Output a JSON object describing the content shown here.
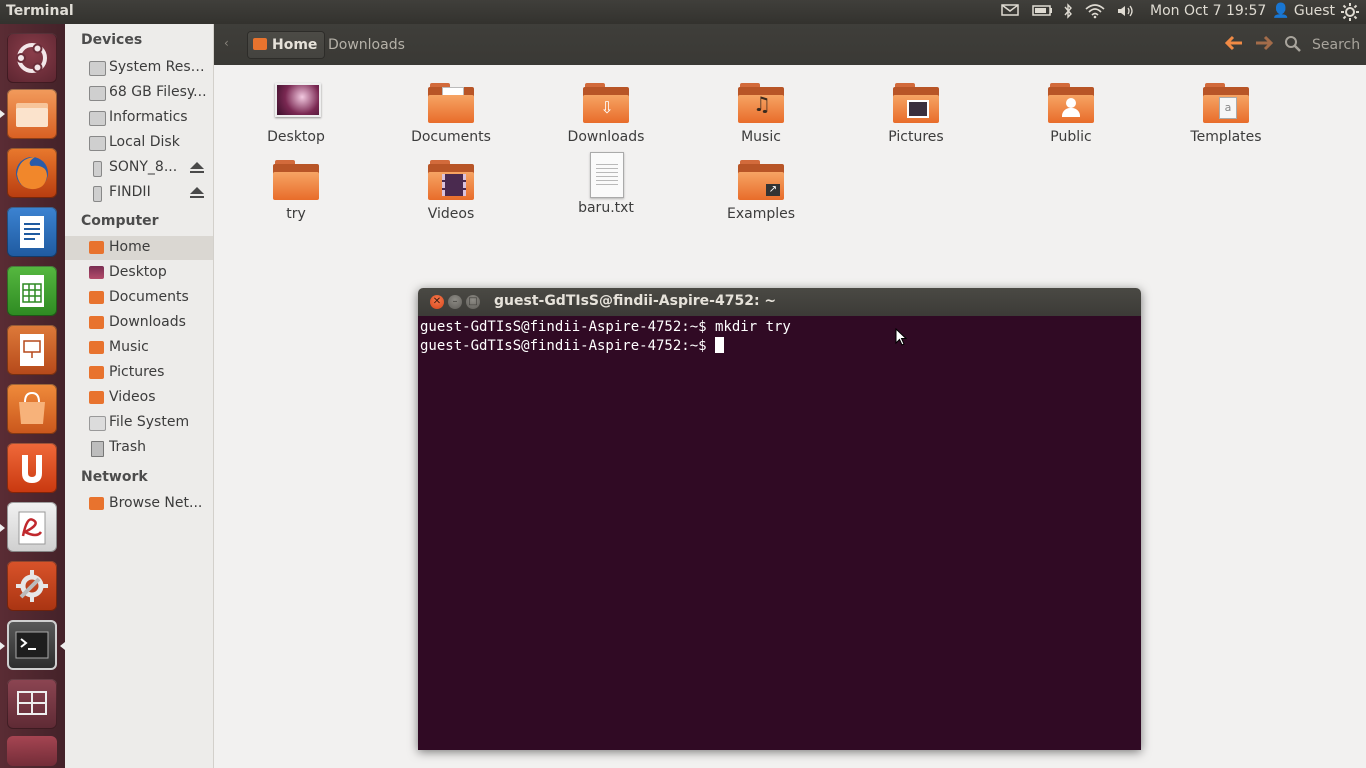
{
  "topbar": {
    "app_title": "Terminal",
    "datetime": "Mon Oct  7 19:57",
    "user": "Guest",
    "indicators": [
      "mail-icon",
      "battery-icon",
      "bluetooth-icon",
      "wifi-icon",
      "volume-icon",
      "power-gear-icon"
    ]
  },
  "launcher": {
    "items": [
      {
        "name": "dash-home",
        "icon": "ubuntu-logo-icon",
        "color": "#6b2e3a"
      },
      {
        "name": "files",
        "icon": "folder-icon",
        "color": "#e8732e",
        "running": true
      },
      {
        "name": "firefox",
        "icon": "firefox-icon",
        "color": "#e66000"
      },
      {
        "name": "libreoffice-writer",
        "icon": "writer-icon",
        "color": "#2a6ebb"
      },
      {
        "name": "libreoffice-calc",
        "icon": "calc-icon",
        "color": "#3f9e2e"
      },
      {
        "name": "libreoffice-impress",
        "icon": "impress-icon",
        "color": "#c5581e"
      },
      {
        "name": "software-center",
        "icon": "software-center-icon",
        "color": "#e2742c"
      },
      {
        "name": "ubuntu-one",
        "icon": "ubuntu-one-icon",
        "color": "#dd4814"
      },
      {
        "name": "document-viewer",
        "icon": "document-viewer-icon",
        "color": "#b02a2a",
        "running": true
      },
      {
        "name": "system-settings",
        "icon": "system-settings-icon",
        "color": "#c14a1c"
      },
      {
        "name": "terminal",
        "icon": "terminal-icon",
        "color": "#2f2f2f",
        "running": true,
        "focused": true
      },
      {
        "name": "workspace-switcher",
        "icon": "workspace-switcher-icon",
        "color": "#7a3b47"
      }
    ]
  },
  "sidebar": {
    "sections": {
      "devices": "Devices",
      "computer": "Computer",
      "network": "Network"
    },
    "devices": [
      {
        "label": "System Rese...",
        "icon": "drive-icon"
      },
      {
        "label": "68 GB Filesy...",
        "icon": "drive-icon"
      },
      {
        "label": "Informatics",
        "icon": "drive-icon"
      },
      {
        "label": "Local Disk",
        "icon": "drive-icon"
      },
      {
        "label": "SONY_8...",
        "icon": "usb-drive-icon",
        "ejectable": true
      },
      {
        "label": "FINDII",
        "icon": "usb-drive-icon",
        "ejectable": true
      }
    ],
    "computer": [
      {
        "label": "Home",
        "icon": "home-folder-icon",
        "selected": true
      },
      {
        "label": "Desktop",
        "icon": "desktop-folder-icon"
      },
      {
        "label": "Documents",
        "icon": "documents-folder-icon"
      },
      {
        "label": "Downloads",
        "icon": "downloads-folder-icon"
      },
      {
        "label": "Music",
        "icon": "music-folder-icon"
      },
      {
        "label": "Pictures",
        "icon": "pictures-folder-icon"
      },
      {
        "label": "Videos",
        "icon": "videos-folder-icon"
      },
      {
        "label": "File System",
        "icon": "filesystem-icon"
      },
      {
        "label": "Trash",
        "icon": "trash-icon"
      }
    ],
    "network": [
      {
        "label": "Browse Net...",
        "icon": "network-icon"
      }
    ]
  },
  "toolbar": {
    "path_home": "Home",
    "path_next": "Downloads",
    "search_label": "Search"
  },
  "files": {
    "row1": [
      {
        "label": "Desktop",
        "kind": "desktop"
      },
      {
        "label": "Documents",
        "kind": "folder",
        "emblem": "document-icon"
      },
      {
        "label": "Downloads",
        "kind": "folder",
        "emblem": "download-arrow-icon"
      },
      {
        "label": "Music",
        "kind": "folder",
        "emblem": "music-note-icon"
      },
      {
        "label": "Pictures",
        "kind": "folder",
        "emblem": "picture-icon"
      },
      {
        "label": "Public",
        "kind": "folder",
        "emblem": "person-icon"
      },
      {
        "label": "Templates",
        "kind": "folder",
        "emblem": "template-icon"
      }
    ],
    "row2": [
      {
        "label": "try",
        "kind": "folder"
      },
      {
        "label": "Videos",
        "kind": "folder",
        "emblem": "film-icon"
      },
      {
        "label": "baru.txt",
        "kind": "text-file"
      },
      {
        "label": "Examples",
        "kind": "folder",
        "emblem": "link-arrow-icon"
      }
    ]
  },
  "terminal": {
    "title": "guest-GdTIsS@findii-Aspire-4752: ~",
    "lines": [
      "guest-GdTIsS@findii-Aspire-4752:~$ mkdir try",
      "guest-GdTIsS@findii-Aspire-4752:~$ "
    ],
    "colors": {
      "background": "#300a24",
      "text": "#ffffff"
    }
  },
  "colors": {
    "accent": "#dd4814",
    "close_button": "#e8542c",
    "folder_orange": "#f08a45"
  }
}
